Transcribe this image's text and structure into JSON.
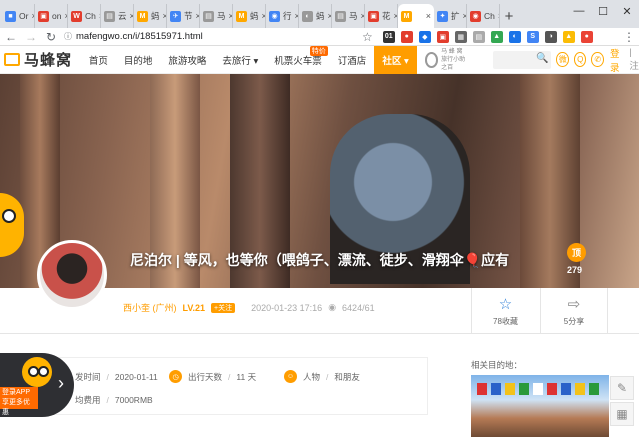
{
  "browser": {
    "tabs": [
      {
        "label": "Or",
        "color": "#4285f4",
        "glyph": "■"
      },
      {
        "label": "on",
        "color": "#e23d2d",
        "glyph": "▣"
      },
      {
        "label": "Ch",
        "color": "#e23d2d",
        "glyph": "W"
      },
      {
        "label": "云",
        "color": "#999999",
        "glyph": "▤"
      },
      {
        "label": "蚂",
        "color": "#ffa800",
        "glyph": "M"
      },
      {
        "label": "节",
        "color": "#4285f4",
        "glyph": "✈"
      },
      {
        "label": "马",
        "color": "#999999",
        "glyph": "▤"
      },
      {
        "label": "蚂",
        "color": "#ffa800",
        "glyph": "M"
      },
      {
        "label": "行",
        "color": "#4285f4",
        "glyph": "◉"
      },
      {
        "label": "蚂",
        "color": "#999999",
        "glyph": "◐"
      },
      {
        "label": "马",
        "color": "#999999",
        "glyph": "▤"
      },
      {
        "label": "花",
        "color": "#e23d2d",
        "glyph": "▣"
      },
      {
        "label": "",
        "color": "#ffa800",
        "glyph": "M"
      },
      {
        "label": "扩",
        "color": "#4285f4",
        "glyph": "✦"
      },
      {
        "label": "Ch",
        "color": "#e23d2d",
        "glyph": "◉"
      }
    ],
    "active_tab_index": 12,
    "url": "mafengwo.cn/i/18515971.html"
  },
  "site": {
    "logo_text": "马蜂窝",
    "nav": [
      {
        "label": "首页"
      },
      {
        "label": "目的地"
      },
      {
        "label": "旅游攻略"
      },
      {
        "label": "去旅行 ▾"
      },
      {
        "label": "机票火车票",
        "badge": "特价"
      },
      {
        "label": "订酒店"
      },
      {
        "label": "社区 ▾",
        "active": true
      }
    ],
    "logo2_lines": [
      "马 蜂 窝",
      "旅行小助之百"
    ],
    "login": "登录",
    "register": "|注"
  },
  "hero": {
    "title": "尼泊尔 | 等风，也等你（喂鸽子、漂流、徒步、滑翔伞🎈应有",
    "ding_label": "顶",
    "ding_count": "279"
  },
  "author": {
    "name": "西小奎 (广州)",
    "level": "LV.21",
    "follow": "+关注",
    "date": "2020-01-23 17:16",
    "views": "6424/61"
  },
  "stats": {
    "favorites": "78收藏",
    "shares": "5分享"
  },
  "trip": {
    "depart_label": "发时间",
    "depart_value": "2020-01-11",
    "days_label": "出行天数",
    "days_value": "11 天",
    "people_label": "人物",
    "people_value": "和朋友",
    "cost_label": "均费用",
    "cost_value": "7000RMB"
  },
  "app_ad": {
    "line1": "登录APP",
    "line2": "享更多优惠"
  },
  "sidebar": {
    "related_title": "相关目的地："
  }
}
